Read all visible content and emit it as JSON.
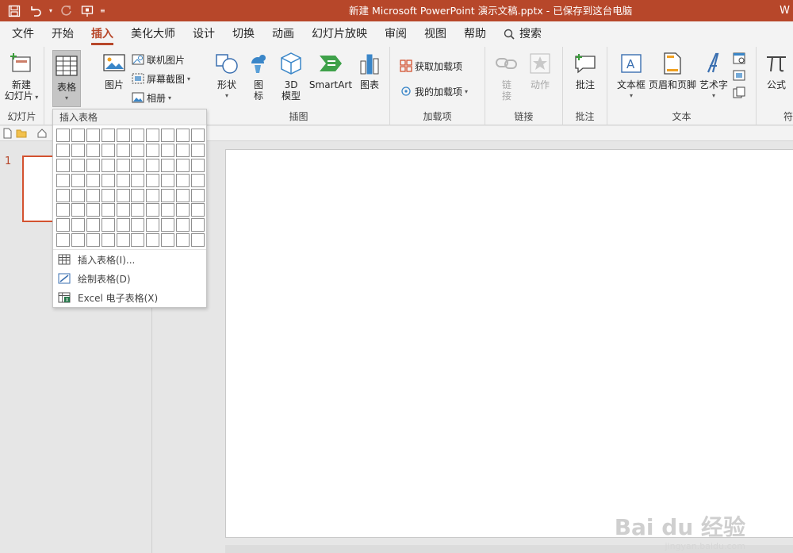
{
  "titlebar": {
    "doc_title": "新建 Microsoft PowerPoint 演示文稿.pptx  -  已保存到这台电脑",
    "user_initial": "W"
  },
  "tabs": [
    "文件",
    "开始",
    "插入",
    "美化大师",
    "设计",
    "切换",
    "动画",
    "幻灯片放映",
    "审阅",
    "视图",
    "帮助"
  ],
  "active_tab": "插入",
  "search_label": "搜索",
  "ribbon": {
    "new_slide": "新建\n幻灯片",
    "new_slide_l1": "新建",
    "new_slide_l2": "幻灯片",
    "slides_group": "幻灯片",
    "table": "表格",
    "picture": "图片",
    "online_picture": "联机图片",
    "screenshot": "屏幕截图",
    "album": "相册",
    "shapes": "形状",
    "icons_l1": "图",
    "icons_l2": "标",
    "model3d_l1": "3D",
    "model3d_l2": "模型",
    "smartart": "SmartArt",
    "chart": "图表",
    "illustrations_group": "插图",
    "get_addins": "获取加载项",
    "my_addins": "我的加载项",
    "addins_group": "加载项",
    "link_l1": "链",
    "link_l2": "接",
    "action": "动作",
    "links_group": "链接",
    "comment": "批注",
    "comments_group": "批注",
    "textbox": "文本框",
    "header_footer": "页眉和页脚",
    "wordart": "艺术字",
    "text_group": "文本",
    "equation": "公式",
    "symbols_group": "符"
  },
  "slide_pane": {
    "slide_number": "1"
  },
  "dropdown": {
    "header": "插入表格",
    "grid_cols": 10,
    "grid_rows": 8,
    "items": [
      "插入表格(I)...",
      "绘制表格(D)",
      "Excel 电子表格(X)"
    ]
  },
  "watermark": {
    "brand": "Bai du 经验",
    "url": "jingyan.baidu.com"
  },
  "colors": {
    "accent": "#b7472a",
    "ribbon_bg": "#f3f3f3",
    "canvas_bg": "#e6e6e6"
  }
}
